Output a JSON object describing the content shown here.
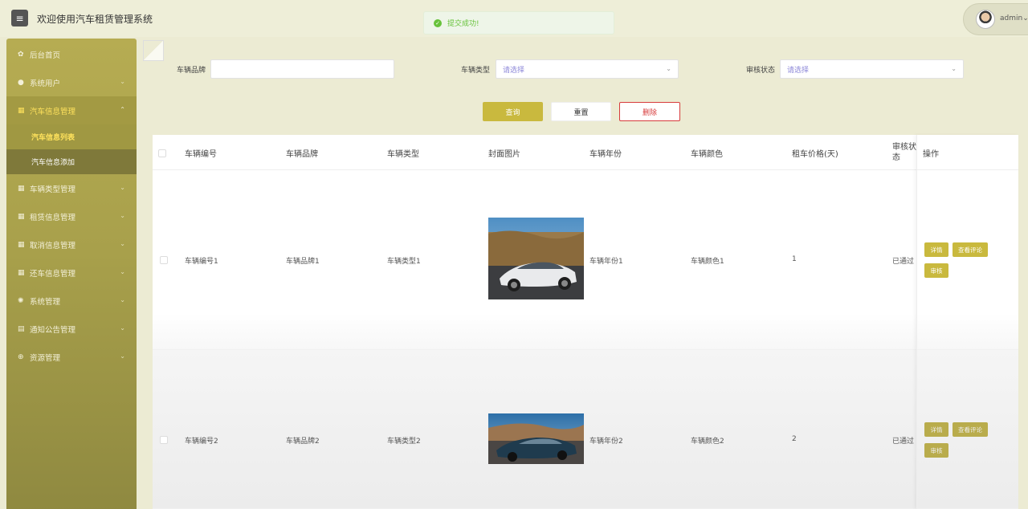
{
  "header": {
    "menu_icon": "hamburger-icon",
    "title": "欢迎使用汽车租赁管理系统",
    "toast": "提交成功!",
    "user": "admin"
  },
  "sidebar": {
    "items": [
      {
        "label": "后台首页",
        "icon": "home-icon"
      },
      {
        "label": "系统用户",
        "icon": "user-icon"
      },
      {
        "label": "汽车信息管理",
        "icon": "grid-icon",
        "open": true,
        "children": [
          {
            "label": "汽车信息列表",
            "active": true
          },
          {
            "label": "汽车信息添加"
          }
        ]
      },
      {
        "label": "车辆类型管理",
        "icon": "grid-icon"
      },
      {
        "label": "租赁信息管理",
        "icon": "grid-icon"
      },
      {
        "label": "取消信息管理",
        "icon": "grid-icon"
      },
      {
        "label": "还车信息管理",
        "icon": "grid-icon"
      },
      {
        "label": "系统管理",
        "icon": "gear-icon"
      },
      {
        "label": "通知公告管理",
        "icon": "document-icon"
      },
      {
        "label": "资源管理",
        "icon": "plus-circle-icon"
      }
    ]
  },
  "filters": {
    "brand_label": "车辆品牌",
    "brand_value": "",
    "type_label": "车辆类型",
    "type_placeholder": "请选择",
    "status_label": "审核状态",
    "status_placeholder": "请选择"
  },
  "actions": {
    "search": "查询",
    "reset": "重置",
    "delete": "删除"
  },
  "table": {
    "columns": [
      "车辆编号",
      "车辆品牌",
      "车辆类型",
      "封面图片",
      "车辆年份",
      "车辆颜色",
      "租车价格(天)",
      "审核状态",
      "操作"
    ],
    "status_col_line1": "审核状",
    "status_col_line2": "态",
    "rows": [
      {
        "id": "车辆编号1",
        "brand": "车辆品牌1",
        "type": "车辆类型1",
        "year": "车辆年份1",
        "color": "车辆颜色1",
        "price": "1",
        "status": "已通过"
      },
      {
        "id": "车辆编号2",
        "brand": "车辆品牌2",
        "type": "车辆类型2",
        "year": "车辆年份2",
        "color": "车辆颜色2",
        "price": "2",
        "status": "已通过"
      }
    ],
    "op_buttons": {
      "detail": "详情",
      "comments": "查看评论",
      "review": "审核"
    }
  },
  "colors": {
    "accent": "#c9b93e",
    "sidebar": "#a8a04b",
    "active_text": "#ffe25c",
    "danger": "#d73b3b",
    "success": "#67c23a"
  }
}
